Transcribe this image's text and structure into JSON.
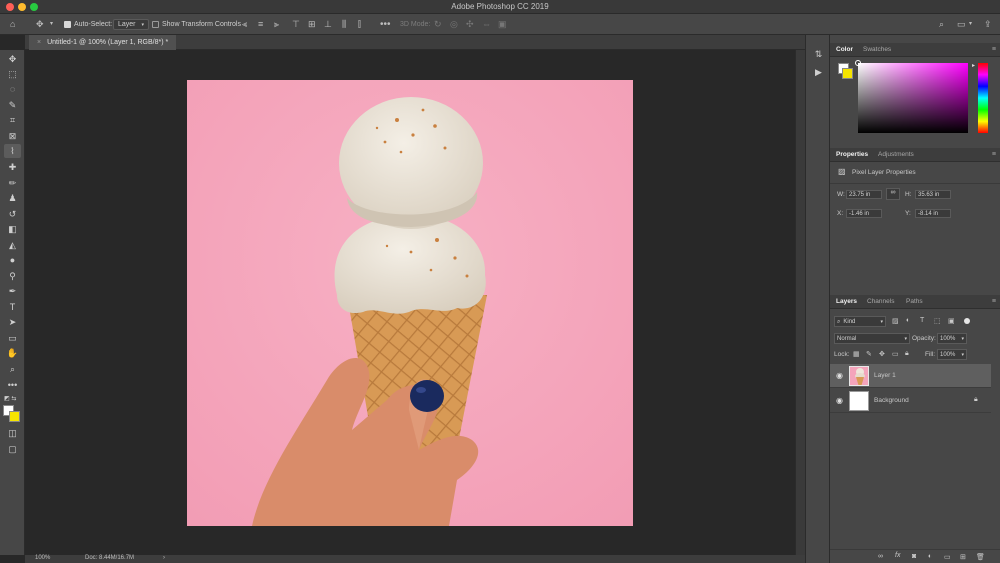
{
  "window": {
    "title": "Adobe Photoshop CC 2019"
  },
  "options": {
    "auto_select_label": "Auto-Select:",
    "auto_select_value": "Layer",
    "transform_label": "Show Transform Controls",
    "mode3d_label": "3D Mode:"
  },
  "document": {
    "tab_label": "Untitled-1 @ 100% (Layer 1, RGB/8*) *"
  },
  "status": {
    "zoom": "100%",
    "doc_size": "Doc: 8.44M/16.7M"
  },
  "color_panel": {
    "tabs": [
      "Color",
      "Swatches"
    ]
  },
  "properties_panel": {
    "tabs": [
      "Properties",
      "Adjustments"
    ],
    "heading": "Pixel Layer Properties",
    "w_label": "W:",
    "w_value": "23.75 in",
    "h_label": "H:",
    "h_value": "35.63 in",
    "x_label": "X:",
    "x_value": "-1.46 in",
    "y_label": "Y:",
    "y_value": "-8.14 in"
  },
  "layers_panel": {
    "tabs": [
      "Layers",
      "Channels",
      "Paths"
    ],
    "filter_label": "Kind",
    "blend_mode": "Normal",
    "opacity_label": "Opacity:",
    "opacity_value": "100%",
    "lock_label": "Lock:",
    "fill_label": "Fill:",
    "fill_value": "100%",
    "layers": [
      {
        "name": "Layer 1",
        "selected": true
      },
      {
        "name": "Background",
        "locked": true
      }
    ]
  },
  "colors": {
    "canvas_pink": "#f4a4bb",
    "fg_swatch": "#ffffff",
    "bg_swatch": "#f5e400"
  }
}
